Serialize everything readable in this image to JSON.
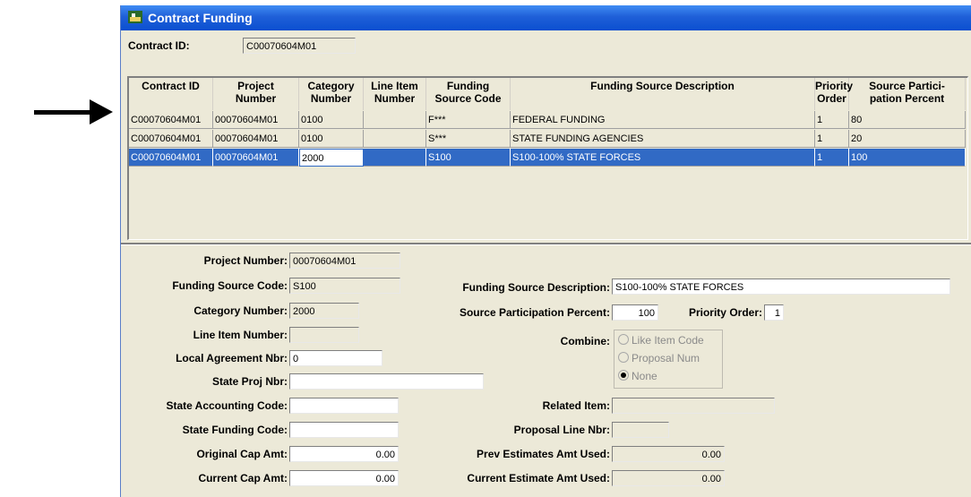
{
  "window": {
    "title": "Contract Funding"
  },
  "header": {
    "contract_id_label": "Contract ID:",
    "contract_id_value": "C00070604M01"
  },
  "grid": {
    "columns": [
      [
        "Contract ID",
        ""
      ],
      [
        "Project",
        "Number"
      ],
      [
        "Category",
        "Number"
      ],
      [
        "Line Item",
        "Number"
      ],
      [
        "Funding",
        "Source Code"
      ],
      [
        "Funding Source Description",
        ""
      ],
      [
        "Priority",
        "Order"
      ],
      [
        "Source Partici-",
        "pation Percent"
      ]
    ],
    "rows": [
      [
        "C00070604M01",
        "00070604M01",
        "0100",
        "",
        "F***",
        "FEDERAL FUNDING",
        "1",
        "80"
      ],
      [
        "C00070604M01",
        "00070604M01",
        "0100",
        "",
        "S***",
        "STATE FUNDING AGENCIES",
        "1",
        "20"
      ],
      [
        "C00070604M01",
        "00070604M01",
        "2000",
        "",
        "S100",
        "S100-100% STATE FORCES",
        "1",
        "100"
      ]
    ],
    "selected_row": 2
  },
  "detail": {
    "project_number": {
      "label": "Project Number:",
      "value": "00070604M01"
    },
    "funding_source_code": {
      "label": "Funding Source Code:",
      "value": "S100"
    },
    "category_number": {
      "label": "Category Number:",
      "value": "2000"
    },
    "line_item_number": {
      "label": "Line Item Number:",
      "value": ""
    },
    "local_agreement_nbr": {
      "label": "Local Agreement Nbr:",
      "value": "0"
    },
    "state_proj_nbr": {
      "label": "State Proj Nbr:",
      "value": ""
    },
    "state_accounting_code": {
      "label": "State Accounting Code:",
      "value": ""
    },
    "state_funding_code": {
      "label": "State Funding Code:",
      "value": ""
    },
    "original_cap_amt": {
      "label": "Original Cap Amt:",
      "value": "0.00"
    },
    "current_cap_amt": {
      "label": "Current Cap Amt:",
      "value": "0.00"
    },
    "funding_source_description": {
      "label": "Funding Source Description:",
      "value": "S100-100% STATE FORCES"
    },
    "source_participation_percent": {
      "label": "Source Participation Percent:",
      "value": "100"
    },
    "priority_order": {
      "label": "Priority Order:",
      "value": "1"
    },
    "combine": {
      "label": "Combine:",
      "options": [
        "Like Item Code",
        "Proposal Num",
        "None"
      ],
      "selected": "None"
    },
    "related_item": {
      "label": "Related Item:",
      "value": ""
    },
    "proposal_line_nbr": {
      "label": "Proposal Line Nbr:",
      "value": ""
    },
    "prev_estimates_amt_used": {
      "label": "Prev Estimates Amt Used:",
      "value": "0.00"
    },
    "current_estimate_amt_used": {
      "label": "Current Estimate Amt Used:",
      "value": "0.00"
    }
  },
  "colors": {
    "title_bar": "#0a4fd0",
    "selection": "#316ac5",
    "window_bg": "#ece9d8"
  }
}
